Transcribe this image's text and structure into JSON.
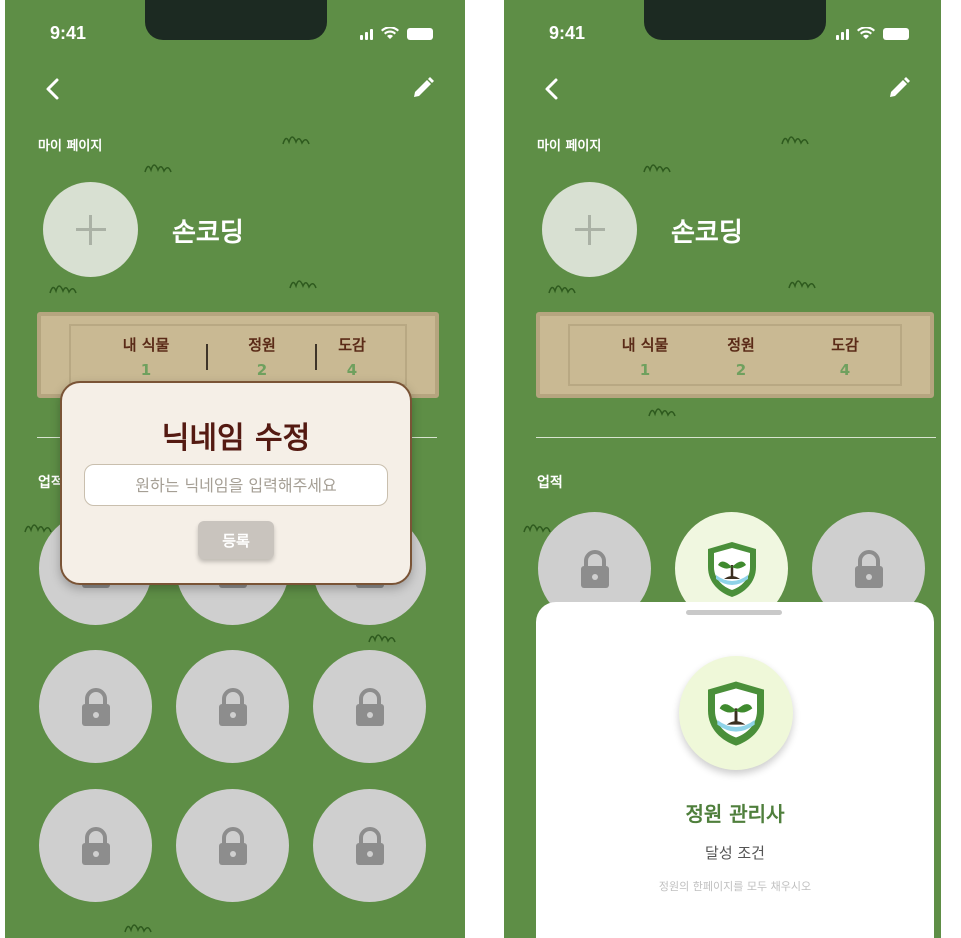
{
  "status_bar": {
    "time": "9:41"
  },
  "profile": {
    "page_title": "마이 페이지",
    "nickname": "손코딩"
  },
  "stats": [
    {
      "label": "내 식물",
      "value": "1"
    },
    {
      "label": "정원",
      "value": "2"
    },
    {
      "label": "도감",
      "value": "4"
    }
  ],
  "achievements": {
    "label": "업적"
  },
  "nickname_dialog": {
    "title": "닉네임 수정",
    "input_placeholder": "원하는 닉네임을 입력해주세요",
    "input_value": "",
    "submit_label": "등록"
  },
  "achievement_sheet": {
    "title": "정원 관리사",
    "subtitle": "달성 조건",
    "description": "정원의 한페이지를 모두 채우시오"
  },
  "colors": {
    "background_green": "#5e8e46",
    "board_tan": "#c9b993",
    "dialog_title_brown": "#541a12",
    "achievement_green": "#4f7f3c",
    "locked_badge_gray": "#cfcfcf"
  },
  "icons": {
    "back": "chevron-left-icon",
    "edit": "pencil-icon",
    "add_photo": "plus-icon",
    "locked": "lock-icon",
    "achievement": "shield-sprout-icon"
  }
}
